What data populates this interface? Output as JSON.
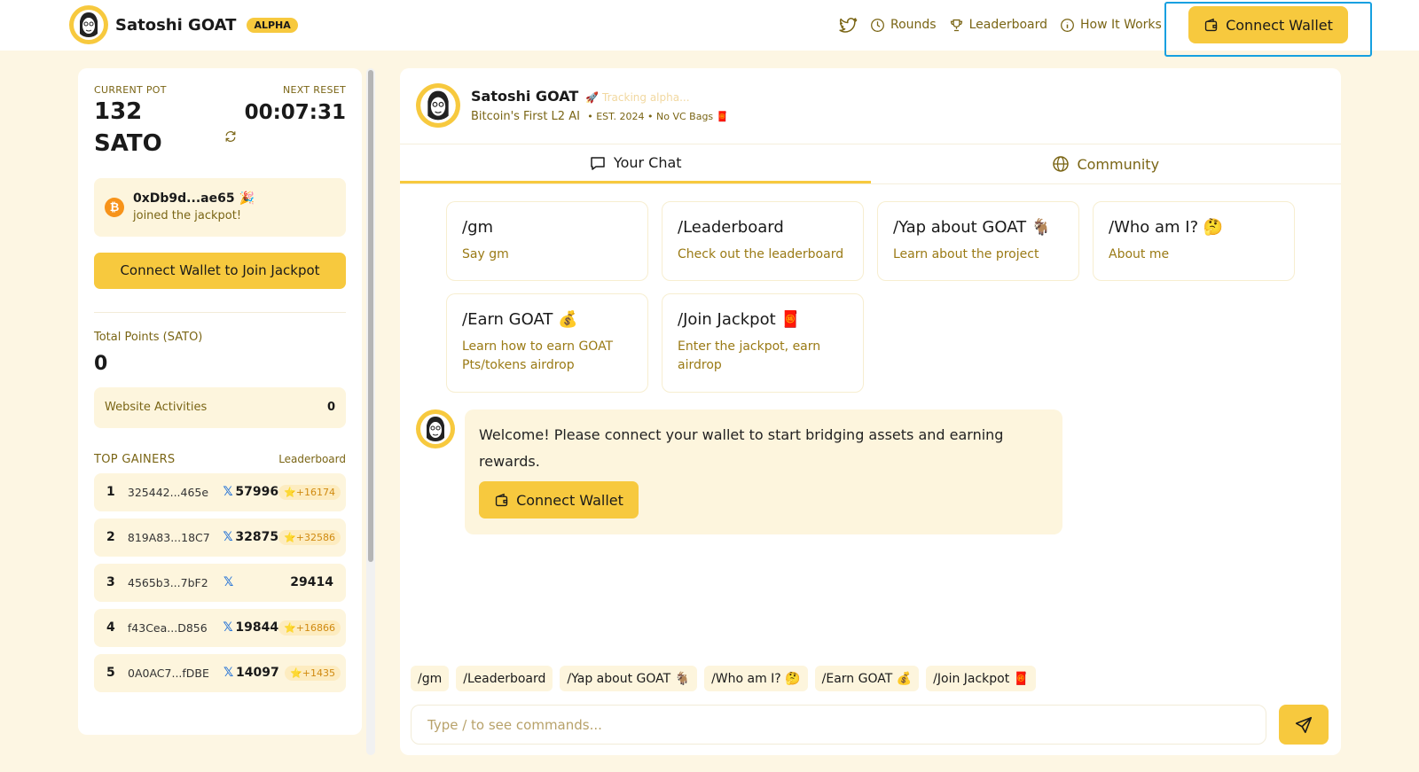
{
  "header": {
    "brand": "Satoshi GOAT",
    "badge": "ALPHA",
    "nav": [
      {
        "label": "Rounds",
        "icon": "clock-icon"
      },
      {
        "label": "Leaderboard",
        "icon": "trophy-icon"
      },
      {
        "label": "How It Works",
        "icon": "info-icon"
      }
    ],
    "connect_label": "Connect Wallet"
  },
  "sidebar": {
    "pot_label": "CURRENT POT",
    "pot_value": "132 SATO",
    "reset_label": "NEXT RESET",
    "reset_value": "00:07:31",
    "event": {
      "address": "0xDb9d...ae65",
      "emoji": "🎉",
      "text": "joined the jackpot!"
    },
    "join_button": "Connect Wallet to Join Jackpot",
    "points_label": "Total Points (SATO)",
    "points_value": "0",
    "activities_label": "Website Activities",
    "activities_value": "0",
    "gainers_title": "TOP GAINERS",
    "gainers_link": "Leaderboard",
    "gainers": [
      {
        "rank": "1",
        "address": "325442...465e",
        "x": "𝕏",
        "score": "57996",
        "bonus": "⭐+16174"
      },
      {
        "rank": "2",
        "address": "819A83...18C7",
        "x": "𝕏",
        "score": "32875",
        "bonus": "⭐+32586"
      },
      {
        "rank": "3",
        "address": "4565b3...7bF2",
        "x": "𝕏",
        "score": "29414",
        "bonus": ""
      },
      {
        "rank": "4",
        "address": "f43Cea...D856",
        "x": "𝕏",
        "score": "19844",
        "bonus": "⭐+16866"
      },
      {
        "rank": "5",
        "address": "0A0AC7...fDBE",
        "x": "𝕏",
        "score": "14097",
        "bonus": "⭐+1435"
      }
    ]
  },
  "chat": {
    "name": "Satoshi GOAT",
    "tracking": "🚀 Tracking alpha...",
    "subtitle": "Bitcoin's First L2 AI",
    "meta": "• EST. 2024 • No VC Bags 🧧",
    "tabs": [
      {
        "label": "Your Chat",
        "icon": "chat-bubble-icon"
      },
      {
        "label": "Community",
        "icon": "globe-icon"
      }
    ],
    "commands": [
      {
        "title": "/gm",
        "desc": "Say gm"
      },
      {
        "title": "/Leaderboard",
        "desc": "Check out the leaderboard"
      },
      {
        "title": "/Yap about GOAT 🐐",
        "desc": "Learn about the project"
      },
      {
        "title": "/Who am I? 🤔",
        "desc": "About me"
      },
      {
        "title": "/Earn GOAT 💰",
        "desc": "Learn how to earn GOAT Pts/tokens airdrop"
      },
      {
        "title": "/Join Jackpot 🧧",
        "desc": "Enter the jackpot, earn airdrop"
      }
    ],
    "welcome": "Welcome! Please connect your wallet to start bridging assets and earning rewards.",
    "welcome_button": "Connect Wallet",
    "quick": [
      "/gm",
      "/Leaderboard",
      "/Yap about GOAT 🐐",
      "/Who am I? 🤔",
      "/Earn GOAT 💰",
      "/Join Jackpot 🧧"
    ],
    "input_placeholder": "Type / to see commands..."
  },
  "colors": {
    "accent": "#f7c93e",
    "background": "#fdf6e3",
    "muted_text": "#7a6515",
    "focus": "#16a0e0"
  }
}
